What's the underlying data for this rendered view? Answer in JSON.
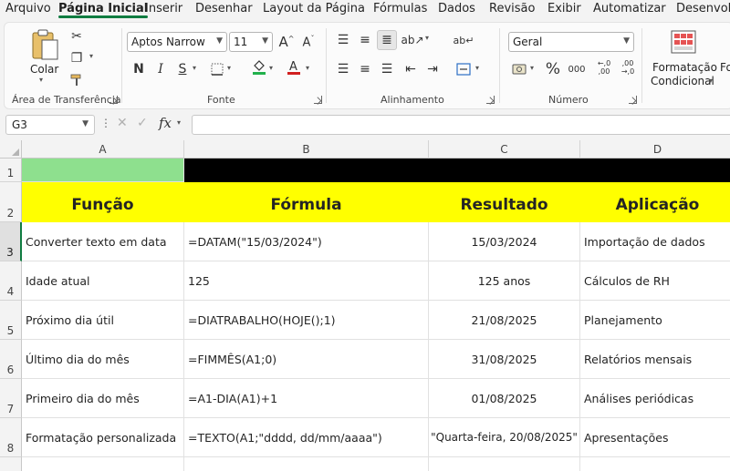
{
  "menu": {
    "tabs": [
      "Arquivo",
      "Página Inicial",
      "Inserir",
      "Desenhar",
      "Layout da Página",
      "Fórmulas",
      "Dados",
      "Revisão",
      "Exibir",
      "Automatizar",
      "Desenvolv"
    ],
    "active_index": 1
  },
  "ribbon": {
    "clipboard": {
      "paste_label": "Colar",
      "group_label": "Área de Transferência"
    },
    "font": {
      "font_name": "Aptos Narrow",
      "font_size": "11",
      "bold": "N",
      "italic": "I",
      "underline": "S",
      "group_label": "Fonte"
    },
    "alignment": {
      "group_label": "Alinhamento"
    },
    "number": {
      "format": "Geral",
      "percent": "%",
      "thousands": "000",
      "inc_decimal": "←,0 ,00",
      "dec_decimal": ",00 →,0",
      "group_label": "Número"
    },
    "styles": {
      "cond_format_line1": "Formatação",
      "cond_format_line2": "Condicional",
      "next_cut": "Fo"
    }
  },
  "formula_bar": {
    "name_box": "G3",
    "fx": "fx",
    "formula": ""
  },
  "grid": {
    "columns": [
      "A",
      "B",
      "C",
      "D"
    ],
    "selected_column": "G",
    "rows": [
      {
        "num": "1",
        "cells": [
          "",
          "",
          "",
          ""
        ]
      },
      {
        "num": "2",
        "cells": [
          "Função",
          "Fórmula",
          "Resultado",
          "Aplicação"
        ]
      },
      {
        "num": "3",
        "cells": [
          "Converter texto em data",
          "=DATAM(\"15/03/2024\")",
          "15/03/2024",
          "Importação de dados"
        ]
      },
      {
        "num": "4",
        "cells": [
          "Idade atual",
          "125",
          "125 anos",
          "Cálculos de RH"
        ]
      },
      {
        "num": "5",
        "cells": [
          "Próximo dia útil",
          "=DIATRABALHO(HOJE();1)",
          "21/08/2025",
          "Planejamento"
        ]
      },
      {
        "num": "6",
        "cells": [
          "Último dia do mês",
          "=FIMMÊS(A1;0)",
          "31/08/2025",
          "Relatórios mensais"
        ]
      },
      {
        "num": "7",
        "cells": [
          "Primeiro dia do mês",
          "=A1-DIA(A1)+1",
          "01/08/2025",
          "Análises periódicas"
        ]
      },
      {
        "num": "8",
        "cells": [
          "Formatação personalizada",
          "=TEXTO(A1;\"dddd, dd/mm/aaaa\")",
          "\"Quarta-feira, 20/08/2025\"",
          "Apresentações"
        ]
      },
      {
        "num": "",
        "cells": [
          "",
          "",
          "",
          ""
        ]
      }
    ]
  },
  "colors": {
    "accent": "#107c41",
    "row1_a": "#8ee08e",
    "row1_rest": "#000000",
    "header_fill": "#ffff00"
  }
}
